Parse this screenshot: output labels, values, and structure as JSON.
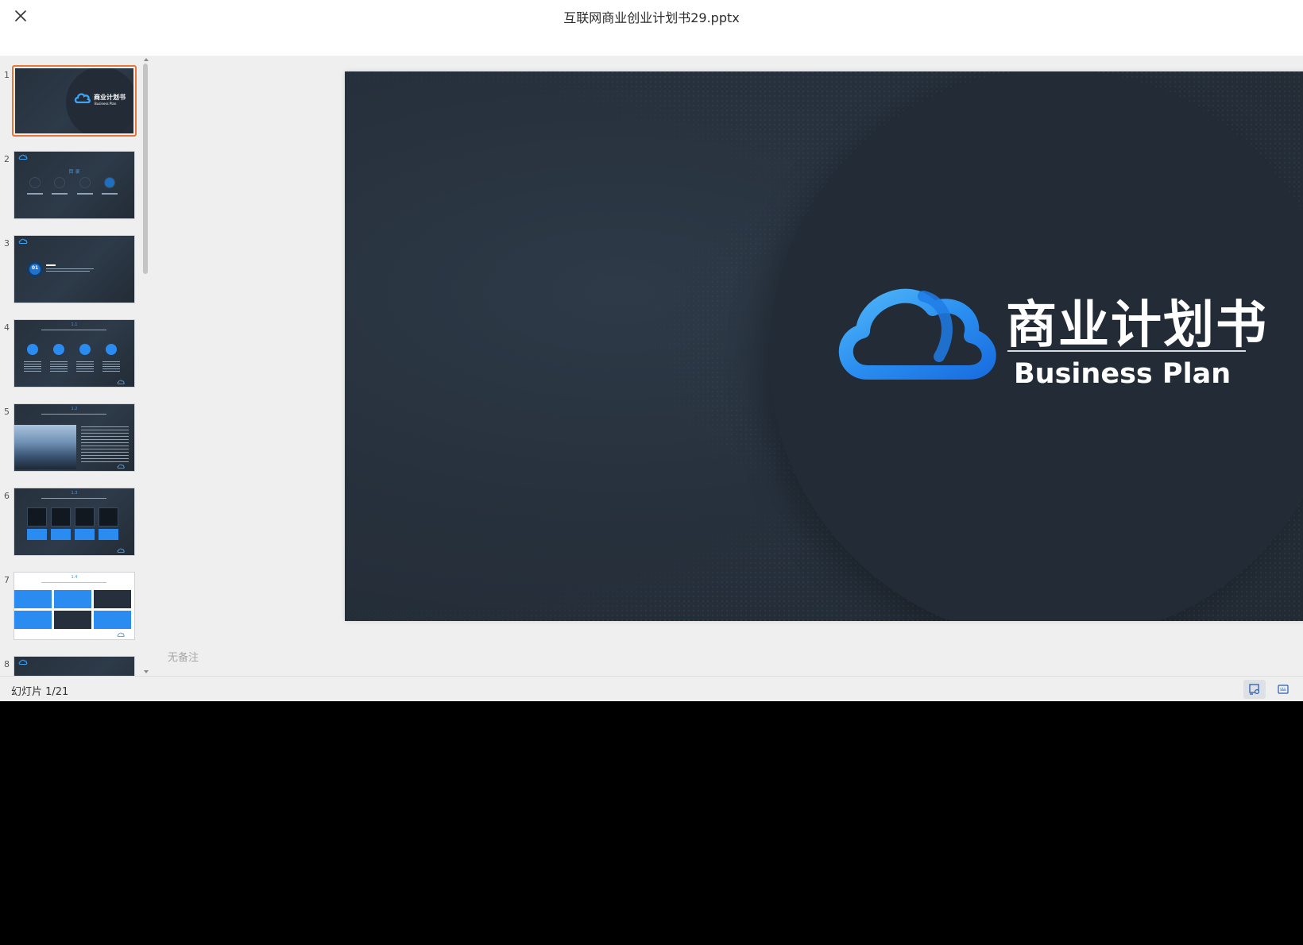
{
  "header": {
    "file_title": "互联网商业创业计划书29.pptx",
    "close_icon": "close-icon"
  },
  "thumbnails": [
    {
      "number": "1",
      "selected": true,
      "heading": "商业计划书",
      "sub": "Business Plan"
    },
    {
      "number": "2",
      "heading": "目 录",
      "sub": ""
    },
    {
      "number": "3",
      "heading": "",
      "sub": "01"
    },
    {
      "number": "4",
      "heading": "1.1 ",
      "sub": ""
    },
    {
      "number": "5",
      "heading": "1.2 ",
      "sub": ""
    },
    {
      "number": "6",
      "heading": "1.3 ",
      "sub": ""
    },
    {
      "number": "7",
      "heading": "1.4 ",
      "sub": ""
    },
    {
      "number": "8",
      "heading": "",
      "sub": ""
    }
  ],
  "main_slide": {
    "title": "商业计划书",
    "subtitle": "Business Plan",
    "logo_icon": "cloud-icon"
  },
  "notes": {
    "placeholder": "无备注"
  },
  "status_bar": {
    "slide_counter": "幻灯片 1/21",
    "notes_toggle_icon": "notes-view-icon",
    "grid_icon": "keyboard-icon"
  },
  "colors": {
    "selected_thumb_border": "#e8753a",
    "slide_bg": "#27313d",
    "accent_blue": "#2a8bf0"
  }
}
